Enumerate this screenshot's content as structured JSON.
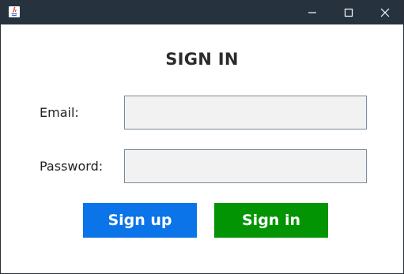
{
  "window": {
    "controls": {
      "minimize_icon": "minimize-icon",
      "maximize_icon": "maximize-icon",
      "close_icon": "close-icon"
    },
    "titlebar_color": "#26323e"
  },
  "form": {
    "title": "SIGN IN",
    "email": {
      "label": "Email:",
      "value": "",
      "placeholder": ""
    },
    "password": {
      "label": "Password:",
      "value": "",
      "placeholder": ""
    },
    "buttons": {
      "signup_label": "Sign up",
      "signin_label": "Sign in",
      "signup_color": "#0a74e8",
      "signin_color": "#029402"
    }
  }
}
